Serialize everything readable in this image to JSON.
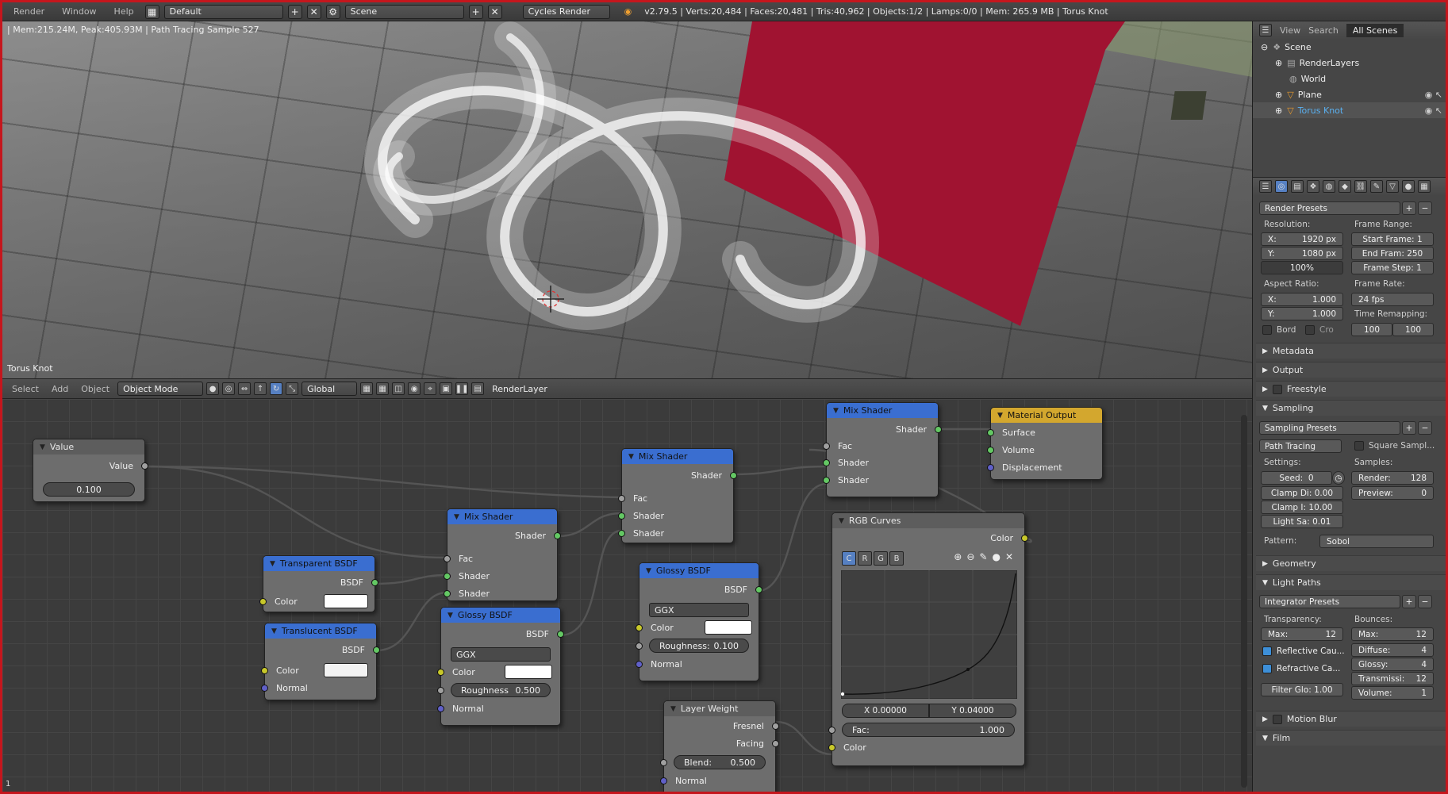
{
  "topbar": {
    "menus": [
      "Render",
      "Window",
      "Help"
    ],
    "layout": "Default",
    "scene": "Scene",
    "engine": "Cycles Render",
    "stats": "v2.79.5 | Verts:20,484 | Faces:20,481 | Tris:40,962 | Objects:1/2 | Lamps:0/0 | Mem: 265.9 MB | Torus Knot"
  },
  "viewport": {
    "render_info": "| Mem:215.24M, Peak:405.93M | Path Tracing Sample 527",
    "object_name": "Torus Knot"
  },
  "view_header": {
    "menus": [
      "Select",
      "Add",
      "Object"
    ],
    "mode": "Object Mode",
    "orientation": "Global",
    "render_layer": "RenderLayer"
  },
  "outliner": {
    "tabs": [
      "View",
      "Search",
      "All Scenes"
    ],
    "items": [
      "Scene",
      "RenderLayers",
      "World",
      "Plane",
      "Torus Knot"
    ]
  },
  "properties": {
    "render_presets": "Render Presets",
    "resolution_label": "Resolution:",
    "res_x": "X:",
    "res_x_val": "1920 px",
    "res_y": "Y:",
    "res_y_val": "1080 px",
    "res_pct": "100%",
    "frame_range_label": "Frame Range:",
    "start_frame": "Start Frame: 1",
    "end_frame": "End Fram: 250",
    "frame_step": "Frame Step: 1",
    "aspect_label": "Aspect Ratio:",
    "aspect_x": "X:",
    "aspect_x_val": "1.000",
    "aspect_y": "Y:",
    "aspect_y_val": "1.000",
    "frame_rate_label": "Frame Rate:",
    "fps": "24 fps",
    "time_remap_label": "Time Remapping:",
    "remap_old": "100",
    "remap_new": "100",
    "bord": "Bord",
    "cro": "Cro",
    "panels_closed": [
      "Metadata",
      "Output",
      "Freestyle"
    ],
    "sampling": "Sampling",
    "sampling_presets": "Sampling Presets",
    "path_tracing": "Path Tracing",
    "square_samples": "Square Sampl...",
    "settings_label": "Settings:",
    "seed_label": "Seed:",
    "seed": "0",
    "clamp_direct": "Clamp Di: 0.00",
    "clamp_indirect": "Clamp I: 10.00",
    "light_sampling": "Light Sa:  0.01",
    "samples_label": "Samples:",
    "render_label": "Render:",
    "render_samples": "128",
    "preview_label": "Preview:",
    "preview_samples": "0",
    "pattern_label": "Pattern:",
    "pattern": "Sobol",
    "geometry": "Geometry",
    "light_paths": "Light Paths",
    "integrator_presets": "Integrator Presets",
    "transparency_label": "Transparency:",
    "transp_max_label": "Max:",
    "transp_max": "12",
    "bounces_label": "Bounces:",
    "bounces_max_label": "Max:",
    "bounces_max": "12",
    "reflective_caustics": "Reflective Cau...",
    "refractive_caustics": "Refractive Ca...",
    "filter_glossy": "Filter Glo: 1.00",
    "diffuse_label": "Diffuse:",
    "diffuse": "4",
    "glossy_label": "Glossy:",
    "glossy": "4",
    "transmission_label": "Transmissi:",
    "transmission": "12",
    "volume_label": "Volume:",
    "volume": "1",
    "motion_blur": "Motion Blur",
    "film": "Film"
  },
  "nodes": {
    "value": {
      "title": "Value",
      "out": "Value",
      "val": "0.100"
    },
    "mix1": {
      "title": "Mix Shader",
      "out": "Shader",
      "fac": "Fac",
      "s1": "Shader",
      "s2": "Shader"
    },
    "mix2": {
      "title": "Mix Shader",
      "out": "Shader",
      "fac": "Fac",
      "s1": "Shader",
      "s2": "Shader"
    },
    "mix3": {
      "title": "Mix Shader",
      "out": "Shader",
      "fac": "Fac",
      "s1": "Shader",
      "s2": "Shader"
    },
    "output": {
      "title": "Material Output",
      "surface": "Surface",
      "volume": "Volume",
      "displacement": "Displacement"
    },
    "transparent": {
      "title": "Transparent BSDF",
      "out": "BSDF",
      "color": "Color"
    },
    "translucent": {
      "title": "Translucent BSDF",
      "out": "BSDF",
      "color": "Color",
      "normal": "Normal"
    },
    "glossy1": {
      "title": "Glossy BSDF",
      "out": "BSDF",
      "dist": "GGX",
      "color": "Color",
      "rough_label": "Roughness",
      "rough": "0.500",
      "normal": "Normal"
    },
    "glossy2": {
      "title": "Glossy BSDF",
      "out": "BSDF",
      "dist": "GGX",
      "color": "Color",
      "rough_label": "Roughness:",
      "rough": "0.100",
      "normal": "Normal"
    },
    "curves": {
      "title": "RGB Curves",
      "out": "Color",
      "channels": [
        "C",
        "R",
        "G",
        "B"
      ],
      "x": "X 0.00000",
      "y": "Y 0.04000",
      "fac_label": "Fac:",
      "fac": "1.000",
      "color": "Color"
    },
    "layer": {
      "title": "Layer Weight",
      "fresnel": "Fresnel",
      "facing": "Facing",
      "blend_label": "Blend:",
      "blend": "0.500",
      "normal": "Normal"
    }
  },
  "corner_num": "1"
}
